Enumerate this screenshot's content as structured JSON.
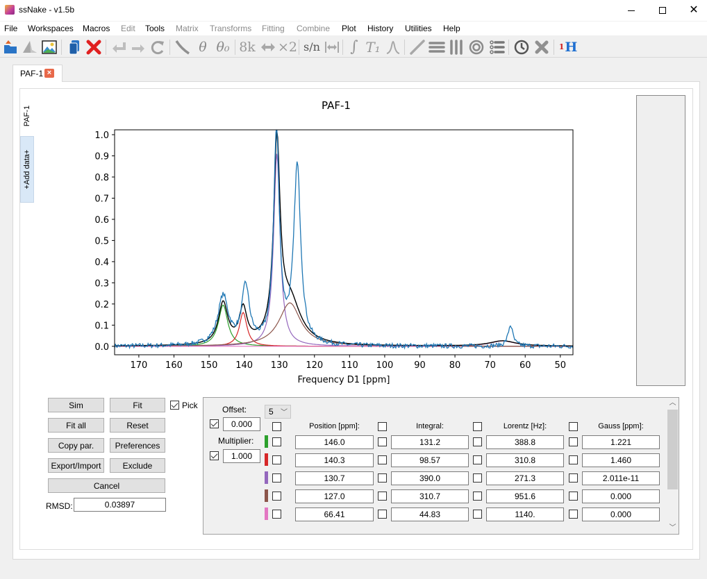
{
  "window": {
    "title": "ssNake - v1.5b",
    "controls": {
      "minimize": "minimize",
      "maximize": "maximize",
      "close": "close"
    }
  },
  "menubar": [
    {
      "label": "File",
      "enabled": true
    },
    {
      "label": "Workspaces",
      "enabled": true
    },
    {
      "label": "Macros",
      "enabled": true
    },
    {
      "label": "Edit",
      "enabled": false
    },
    {
      "label": "Tools",
      "enabled": true
    },
    {
      "label": "Matrix",
      "enabled": false
    },
    {
      "label": "Transforms",
      "enabled": false
    },
    {
      "label": "Fitting",
      "enabled": false
    },
    {
      "label": "Combine",
      "enabled": false
    },
    {
      "label": "Plot",
      "enabled": true
    },
    {
      "label": "History",
      "enabled": true
    },
    {
      "label": "Utilities",
      "enabled": true
    },
    {
      "label": "Help",
      "enabled": true
    }
  ],
  "toolbar": {
    "icons": [
      "open-folder-icon",
      "spectrum-icon",
      "image-icon",
      "copy-icon",
      "delete-icon",
      "undo-icon",
      "redo-icon",
      "reload-icon",
      "baseline-icon",
      "phase-icon",
      "phase0-icon",
      "8k-icon",
      "swap-icon",
      "double-icon",
      "sn-icon",
      "width-icon",
      "integral-icon",
      "t1-icon",
      "peak-icon",
      "line-icon",
      "stack-icon",
      "array-icon",
      "contour-icon",
      "multiplot-icon",
      "clock-icon",
      "close-gray-icon",
      "nucleus-icon"
    ],
    "text": {
      "k8": "8k",
      "x2": "×2",
      "sn": "s/n",
      "theta": "θ",
      "theta0": "θ₀",
      "integral": "∫",
      "t1": "T₁",
      "peak": "⋀",
      "nucleus_sup": "1",
      "nucleus": "H"
    }
  },
  "workspace_tab": {
    "label": "PAF-1",
    "close": "×"
  },
  "side_tabs": [
    {
      "label": "PAF-1"
    },
    {
      "label": "+Add data+"
    }
  ],
  "chart_data": {
    "type": "line",
    "title": "PAF-1",
    "xlabel": "Frequency D1 [ppm]",
    "ylabel": "",
    "xlim": [
      176.9,
      46.4
    ],
    "ylim": [
      -0.04,
      1.023
    ],
    "xticks": [
      170,
      160,
      150,
      140,
      130,
      120,
      110,
      100,
      90,
      80,
      70,
      60,
      50
    ],
    "yticks": [
      0.0,
      0.1,
      0.2,
      0.3,
      0.4,
      0.5,
      0.6,
      0.7,
      0.8,
      0.9,
      1.0
    ],
    "ytick_labels": [
      "0.0",
      "0.1",
      "0.2",
      "0.3",
      "0.4",
      "0.5",
      "0.6",
      "0.7",
      "0.8",
      "0.9",
      "1.0"
    ],
    "grid": false,
    "series": [
      {
        "name": "data",
        "color": "#1f77b4",
        "peaks": [
          {
            "pos": 146.0,
            "height": 0.23
          },
          {
            "pos": 139.6,
            "height": 0.27
          },
          {
            "pos": 130.8,
            "height": 1.0
          },
          {
            "pos": 124.9,
            "height": 0.84
          },
          {
            "pos": 64.2,
            "height": 0.1
          }
        ],
        "noise": 0.01
      },
      {
        "name": "fit-total",
        "color": "#000000"
      },
      {
        "name": "site-1",
        "color": "#2ca02c",
        "pos": 146.0,
        "height": 0.195,
        "width": 3.2
      },
      {
        "name": "site-2",
        "color": "#d62728",
        "pos": 140.3,
        "height": 0.16,
        "width": 2.6
      },
      {
        "name": "site-3",
        "color": "#9467bd",
        "pos": 130.7,
        "height": 0.91,
        "width": 2.2
      },
      {
        "name": "site-4",
        "color": "#8c564b",
        "pos": 127.0,
        "height": 0.205,
        "width": 7.5
      },
      {
        "name": "site-5",
        "color": "#e377c2",
        "pos": 66.41,
        "height": 0.025,
        "width": 9.0
      }
    ]
  },
  "fit_controls": {
    "buttons": {
      "sim": "Sim",
      "fit": "Fit",
      "fit_all": "Fit all",
      "reset": "Reset",
      "copy_par": "Copy par.",
      "preferences": "Preferences",
      "export_import": "Export/Import",
      "exclude": "Exclude",
      "cancel": "Cancel"
    },
    "pick": {
      "label": "Pick",
      "checked": true
    },
    "rmsd_label": "RMSD:",
    "rmsd_value": "0.03897"
  },
  "params": {
    "offset_label": "Offset:",
    "offset_value": "0.000",
    "offset_checked": true,
    "multiplier_label": "Multiplier:",
    "multiplier_value": "1.000",
    "multiplier_checked": true,
    "num_sites": "5",
    "columns": [
      "Position [ppm]:",
      "Integral:",
      "Lorentz [Hz]:",
      "Gauss [ppm]:"
    ],
    "rows": [
      {
        "color": "#2ca02c",
        "values": [
          "146.0",
          "131.2",
          "388.8",
          "1.221"
        ]
      },
      {
        "color": "#d62728",
        "values": [
          "140.3",
          "98.57",
          "310.8",
          "1.460"
        ]
      },
      {
        "color": "#9467bd",
        "values": [
          "130.7",
          "390.0",
          "271.3",
          "2.011e-11"
        ]
      },
      {
        "color": "#8c564b",
        "values": [
          "127.0",
          "310.7",
          "951.6",
          "0.000"
        ]
      },
      {
        "color": "#e377c2",
        "values": [
          "66.41",
          "44.83",
          "1140.",
          "0.000"
        ]
      }
    ]
  }
}
